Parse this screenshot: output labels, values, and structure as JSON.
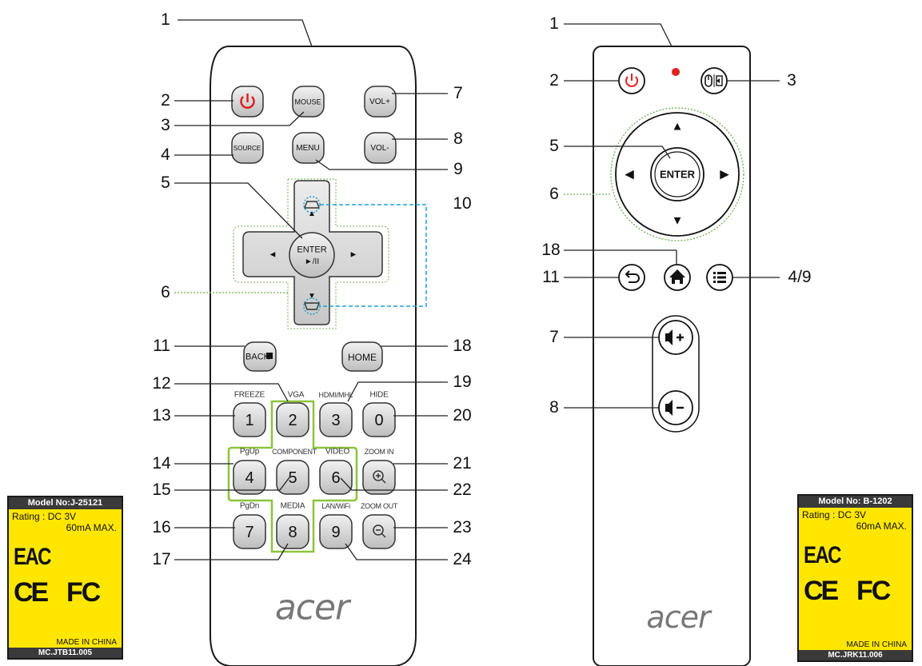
{
  "remote_left": {
    "callouts": [
      "1",
      "2",
      "3",
      "4",
      "5",
      "6",
      "7",
      "8",
      "9",
      "10",
      "11",
      "12",
      "13",
      "14",
      "15",
      "16",
      "17",
      "18",
      "19",
      "20",
      "21",
      "22",
      "23",
      "24"
    ],
    "buttons": {
      "mouse": "MOUSE",
      "vol_up": "VOL+",
      "source": "SOURCE",
      "menu": "MENU",
      "vol_down": "VOL-",
      "enter": "ENTER",
      "play_pause": "►/II",
      "back": "BACK",
      "home": "HOME",
      "n1": "1",
      "n2": "2",
      "n3": "3",
      "n0": "0",
      "n4": "4",
      "n5": "5",
      "n6": "6",
      "n7": "7",
      "n8": "8",
      "n9": "9",
      "up": "▲",
      "down": "▼",
      "left": "◄",
      "right": "►",
      "zoom_in_glyph": "⊕",
      "zoom_out_glyph": "⊖"
    },
    "captions": {
      "freeze": "FREEZE",
      "vga": "VGA",
      "hdmi": "HDMI/MHL",
      "hide": "HIDE",
      "pgup": "PgUp",
      "component": "COMPONENT",
      "video": "VIDEO",
      "zoom_in": "ZOOM IN",
      "pgdn": "PgDn",
      "media": "MEDIA",
      "lanwifi": "LAN/WiFi",
      "zoom_out": "ZOOM OUT"
    },
    "logo": "acer",
    "sticker": {
      "model": "Model No:J-25121",
      "rating": "Rating : DC 3V",
      "current": "60mA MAX.",
      "eac": "EAC",
      "ce": "CE",
      "fc": "FC",
      "made": "MADE IN CHINA",
      "part": "MC.JTB11.005"
    }
  },
  "remote_right": {
    "callouts": [
      "1",
      "2",
      "3",
      "5",
      "6",
      "18",
      "11",
      "4/9",
      "7",
      "8"
    ],
    "buttons": {
      "enter": "ENTER",
      "up": "▲",
      "down": "▼",
      "left": "◀",
      "right": "▶",
      "home_glyph": "⌂",
      "back_glyph": "↩",
      "vol_up": "◀+",
      "vol_down": "◀−"
    },
    "logo": "acer",
    "sticker": {
      "model": "Model No: B-1202",
      "rating": "Rating : DC 3V",
      "current": "60mA MAX.",
      "eac": "EAC",
      "ce": "CE",
      "fc": "FC",
      "made": "MADE IN CHINA",
      "part": "MC.JRK11.006"
    }
  },
  "colors": {
    "power_red": "#e02020",
    "led_red": "#e02020",
    "dotted_green": "#6ab24a",
    "dotted_blue": "#1aa0d8",
    "highlight_green": "#8cc43c",
    "sticker_yellow": "#ffe600"
  },
  "icons": [
    "power-icon",
    "mouse-input-icon",
    "arrow-icons",
    "keystone-icon",
    "zoom-in-icon",
    "zoom-out-icon",
    "home-icon",
    "back-icon",
    "list-menu-icon",
    "speaker-icon",
    "recycle-bin-icon"
  ]
}
